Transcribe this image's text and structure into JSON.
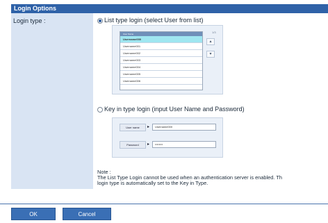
{
  "header": {
    "title": "Login Options"
  },
  "form": {
    "login_type_label": "Login type :",
    "options": [
      {
        "label": "List type login (select User from list)",
        "checked": true
      },
      {
        "label": "Key in type login (input User Name and Password)",
        "checked": false
      }
    ]
  },
  "list_panel": {
    "caption": "User Name",
    "counter": "1/3",
    "items": [
      "Username000",
      "Username001",
      "Username002",
      "Username003",
      "Username004",
      "Username005",
      "Username006"
    ],
    "selected_index": 0,
    "scroll_up": "▴",
    "scroll_down": "▾"
  },
  "keyin_panel": {
    "user_name_label": "User name",
    "user_name_value": "Username000",
    "password_label": "Password",
    "password_value": "••••••••",
    "arrow": "▸"
  },
  "note": {
    "title": "Note :",
    "line1": "The List Type Login cannot be used when an authentication server is enabled. Th",
    "line2": "login type is automatically set to the Key in Type."
  },
  "buttons": {
    "ok": "OK",
    "cancel": "Cancel"
  },
  "colors": {
    "header": "#2f62a8",
    "left_column": "#d9e4f3",
    "selected_row": "#9fe6f0",
    "button": "#3a6fb5"
  }
}
